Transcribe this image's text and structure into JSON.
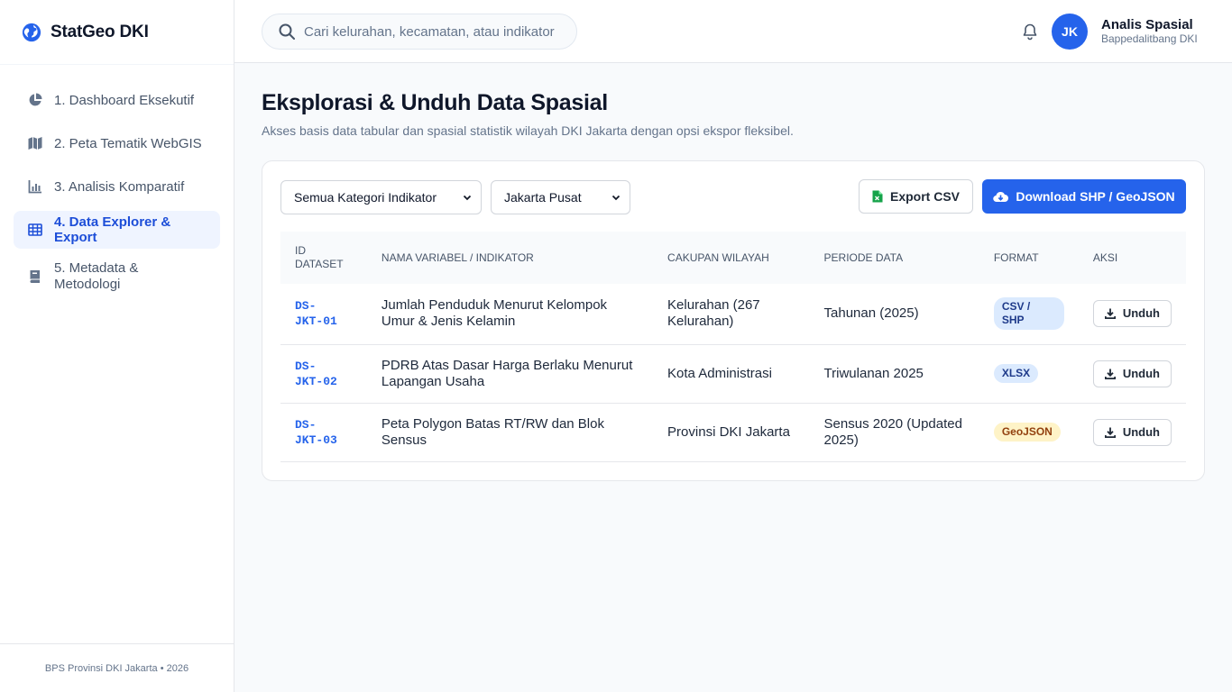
{
  "brand": {
    "name": "StatGeo DKI"
  },
  "nav": {
    "items": [
      {
        "label": "1. Dashboard Eksekutif"
      },
      {
        "label": "2. Peta Tematik WebGIS"
      },
      {
        "label": "3. Analisis Komparatif"
      },
      {
        "label": "4. Data Explorer & Export"
      },
      {
        "label": "5. Metadata & Metodologi"
      }
    ]
  },
  "footer": {
    "text": "BPS Provinsi DKI Jakarta • 2026"
  },
  "search": {
    "placeholder": "Cari kelurahan, kecamatan, atau indikator statistik"
  },
  "user": {
    "initials": "JK",
    "name": "Analis Spasial",
    "org": "Bappedalitbang DKI"
  },
  "page": {
    "title": "Eksplorasi & Unduh Data Spasial",
    "subtitle": "Akses basis data tabular dan spasial statistik wilayah DKI Jakarta dengan opsi ekspor fleksibel."
  },
  "filters": {
    "category_selected": "Semua Kategori Indikator",
    "region_selected": "Jakarta Pusat"
  },
  "actions": {
    "export_csv": "Export CSV",
    "download_shp": "Download SHP / GeoJSON"
  },
  "table": {
    "headers": [
      "ID DATASET",
      "NAMA VARIABEL / INDIKATOR",
      "CAKUPAN WILAYAH",
      "PERIODE DATA",
      "FORMAT",
      "AKSI"
    ],
    "rows": [
      {
        "id": "DS-JKT-01",
        "name": "Jumlah Penduduk Menurut Kelompok Umur & Jenis Kelamin",
        "coverage": "Kelurahan (267 Kelurahan)",
        "period": "Tahunan (2025)",
        "format": "CSV / SHP",
        "action": "Unduh"
      },
      {
        "id": "DS-JKT-02",
        "name": "PDRB Atas Dasar Harga Berlaku Menurut Lapangan Usaha",
        "coverage": "Kota Administrasi",
        "period": "Triwulanan 2025",
        "format": "XLSX",
        "action": "Unduh"
      },
      {
        "id": "DS-JKT-03",
        "name": "Peta Polygon Batas RT/RW dan Blok Sensus",
        "coverage": "Provinsi DKI Jakarta",
        "period": "Sensus 2020 (Updated 2025)",
        "format": "GeoJSON",
        "action": "Unduh"
      }
    ]
  },
  "colors": {
    "accent": "#2563eb",
    "active_bg": "#eff4ff",
    "badge_blue": "#dbeafe",
    "badge_amber": "#fef3c7"
  },
  "icons": {
    "brand": "globe-icon",
    "nav": [
      "pie-chart-icon",
      "map-icon",
      "bar-chart-icon",
      "table-icon",
      "book-icon"
    ],
    "search": "search-icon",
    "notification": "bell-icon",
    "csv": "file-spreadsheet-icon",
    "download_shp": "cloud-download-icon",
    "row_download": "download-icon"
  }
}
